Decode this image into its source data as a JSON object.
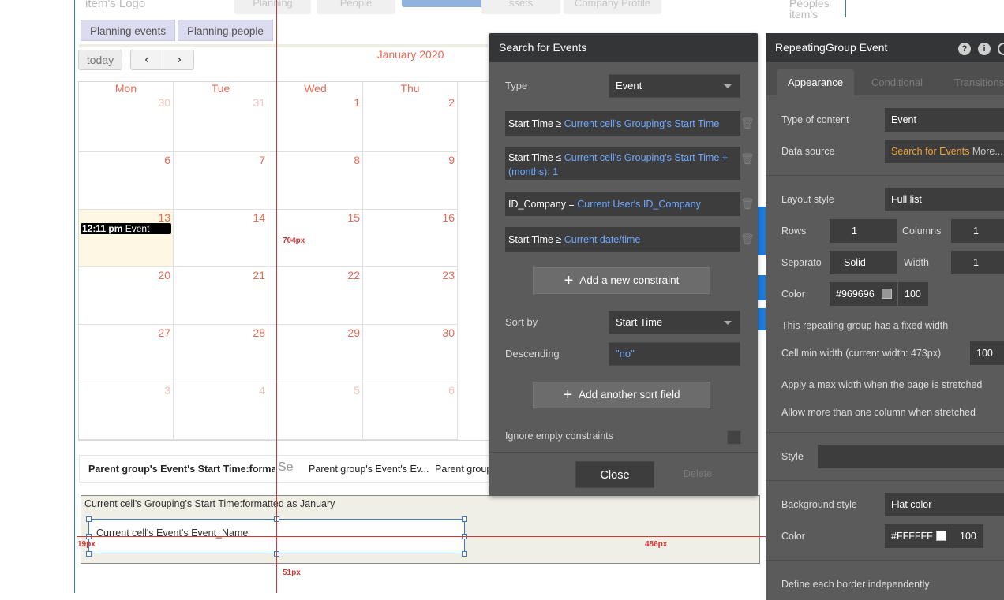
{
  "header": {
    "logo_text": "item's Logo",
    "ghost_tabs": [
      "Planning",
      "People",
      "",
      "ssets",
      "Company Profile"
    ],
    "right_ghost_1": "Peoples",
    "right_ghost_2": "item's"
  },
  "nav": {
    "tab1": "Planning events",
    "tab2": "Planning people"
  },
  "calendar": {
    "today_label": "today",
    "prev_icon": "‹",
    "next_icon": "›",
    "month_title": "January 2020",
    "days": [
      "Mon",
      "Tue",
      "Wed",
      "Thu"
    ],
    "weeks": [
      [
        {
          "n": "30",
          "dim": true
        },
        {
          "n": "31",
          "dim": true
        },
        {
          "n": "1"
        },
        {
          "n": "2"
        }
      ],
      [
        {
          "n": "6"
        },
        {
          "n": "7"
        },
        {
          "n": "8"
        },
        {
          "n": "9"
        }
      ],
      [
        {
          "n": "13",
          "today": true
        },
        {
          "n": "14"
        },
        {
          "n": "15"
        },
        {
          "n": "16"
        }
      ],
      [
        {
          "n": "20"
        },
        {
          "n": "21"
        },
        {
          "n": "22"
        },
        {
          "n": "23"
        }
      ],
      [
        {
          "n": "27"
        },
        {
          "n": "28"
        },
        {
          "n": "29"
        },
        {
          "n": "30"
        }
      ],
      [
        {
          "n": "3",
          "dim": true
        },
        {
          "n": "4",
          "dim": true
        },
        {
          "n": "5",
          "dim": true
        },
        {
          "n": "6",
          "dim": true
        }
      ]
    ],
    "event_time": "12:11 pm",
    "event_name": "Event"
  },
  "measures": {
    "m704": "704px",
    "m19": "19px",
    "m486": "486px",
    "m51": "51px"
  },
  "text_row": {
    "t1": "Parent group's Event's Start Time:forma...",
    "t2": "Se",
    "t3": "Parent group's Event's Ev...",
    "t4": "Parent group"
  },
  "group": {
    "title": "Current cell's Grouping's Start Time:formatted as January",
    "cell_text": "Current cell's Event's Event_Name"
  },
  "search_panel": {
    "title": "Search for Events",
    "type_label": "Type",
    "type_value": "Event",
    "constraints": [
      {
        "field": "Start Time ≥",
        "value": "Current cell's Grouping's Start Time"
      },
      {
        "field": "Start Time ≤",
        "value": "Current cell's Grouping's Start Time + (months): 1"
      },
      {
        "field": "ID_Company =",
        "value": "Current User's ID_Company"
      },
      {
        "field": "Start Time ≥",
        "value": "Current date/time"
      }
    ],
    "add_constraint": "Add a new constraint",
    "sort_label": "Sort by",
    "sort_value": "Start Time",
    "desc_label": "Descending",
    "desc_value": "\"no\"",
    "add_sort": "Add another sort field",
    "ignore_label": "Ignore empty constraints",
    "close": "Close",
    "delete": "Delete"
  },
  "props": {
    "title": "RepeatingGroup Event",
    "tabs": [
      "Appearance",
      "Conditional",
      "Transitions"
    ],
    "type_label": "Type of content",
    "type_value": "Event",
    "source_label": "Data source",
    "source_value": "Search for Events",
    "source_more": "More...",
    "layout_label": "Layout style",
    "layout_value": "Full list",
    "rows_label": "Rows",
    "rows_value": "1",
    "cols_label": "Columns",
    "cols_value": "1",
    "sep_label": "Separato",
    "sep_value": "Solid",
    "width_label": "Width",
    "width_value": "1",
    "color_label": "Color",
    "color_value": "#969696",
    "color_opacity": "100",
    "fixed_width": "This repeating group has a fixed width",
    "cell_min": "Cell min width (current width: 473px)",
    "cell_min_value": "100",
    "max_width": "Apply a max width when the page is stretched",
    "multi_col": "Allow more than one column when stretched",
    "style_label": "Style",
    "bg_label": "Background style",
    "bg_value": "Flat color",
    "bg_color_label": "Color",
    "bg_color_value": "#FFFFFF",
    "bg_opacity": "100",
    "border_label": "Define each border independently"
  },
  "colors": {
    "accent_red": "#d13535",
    "cal_red": "#e86a55",
    "dynamic_blue": "#6fa8ff",
    "panel_gray": "#5b5b5b"
  }
}
